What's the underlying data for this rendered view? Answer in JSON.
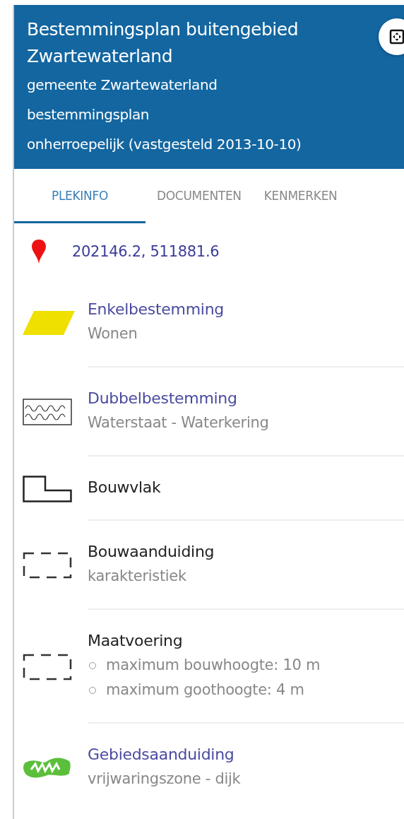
{
  "header": {
    "title": "Bestemmingsplan buitengebied Zwartewaterland",
    "lines": [
      "gemeente Zwartewaterland",
      "bestemmingsplan",
      "onherroepelijk (vastgesteld 2013-10-10)"
    ]
  },
  "tabs": [
    {
      "label": "PLEKINFO",
      "selected": true
    },
    {
      "label": "DOCUMENTEN",
      "selected": false
    },
    {
      "label": "KENMERKEN",
      "selected": false
    }
  ],
  "location": {
    "coordinates": "202146.2, 511881.6"
  },
  "items": [
    {
      "kind": "enkelbestemming",
      "title": "Enkelbestemming",
      "link": true,
      "subtitle": "Wonen"
    },
    {
      "kind": "dubbelbestemming",
      "title": "Dubbelbestemming",
      "link": true,
      "subtitle": "Waterstaat - Waterkering"
    },
    {
      "kind": "bouwvlak",
      "title": "Bouwvlak",
      "link": false
    },
    {
      "kind": "aanduiding",
      "title": "Bouwaanduiding",
      "link": false,
      "subtitle": "karakteristiek"
    },
    {
      "kind": "aanduiding",
      "title": "Maatvoering",
      "link": false,
      "bullets": [
        "maximum bouwhoogte: 10 m",
        "maximum goothoogte: 4 m"
      ]
    },
    {
      "kind": "gebiedsaanduiding",
      "title": "Gebiedsaanduiding",
      "link": true,
      "subtitle": "vrijwaringszone - dijk"
    }
  ]
}
